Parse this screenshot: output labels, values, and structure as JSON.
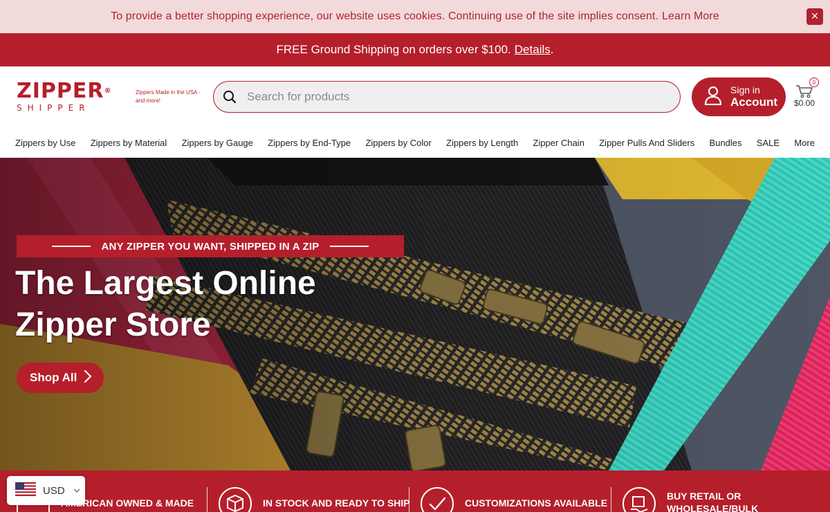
{
  "cookie_bar": {
    "message": "To provide a better shopping experience, our website uses cookies. Continuing use of the site implies consent.",
    "link": "Learn More",
    "close": "✕"
  },
  "shipping_bar": {
    "message": "FREE Ground Shipping on orders over $100.",
    "link": "Details",
    "suffix": "."
  },
  "header": {
    "logo_top": "ZIPPER",
    "logo_reg": "®",
    "logo_bottom": "SHIPPER",
    "tagline": "Zippers Made in the USA - and more!",
    "search_placeholder": "Search for products",
    "account_small": "Sign in",
    "account_big": "Account",
    "cart_count": "0",
    "cart_total": "$0.00"
  },
  "nav": {
    "items": [
      "Zippers by Use",
      "Zippers by Material",
      "Zippers by Gauge",
      "Zippers by End-Type",
      "Zippers by Color",
      "Zippers by Length",
      "Zipper Chain",
      "Zipper Pulls And Sliders",
      "Bundles",
      "SALE",
      "More"
    ]
  },
  "hero": {
    "banner": "ANY ZIPPER YOU WANT, SHIPPED IN A ZIP",
    "title": "The Largest Online Zipper Store",
    "cta": "Shop All"
  },
  "features": {
    "items": [
      {
        "label": "AMERICAN OWNED & MADE"
      },
      {
        "label": "IN STOCK AND READY TO SHIP"
      },
      {
        "label": "CUSTOMIZATIONS AVAILABLE"
      },
      {
        "label": "BUY RETAIL OR WHOLESALE/BULK"
      }
    ]
  },
  "currency": {
    "code": "USD"
  },
  "colors": {
    "brand": "#b51f2b",
    "cookie_bg": "#f2d9da"
  }
}
